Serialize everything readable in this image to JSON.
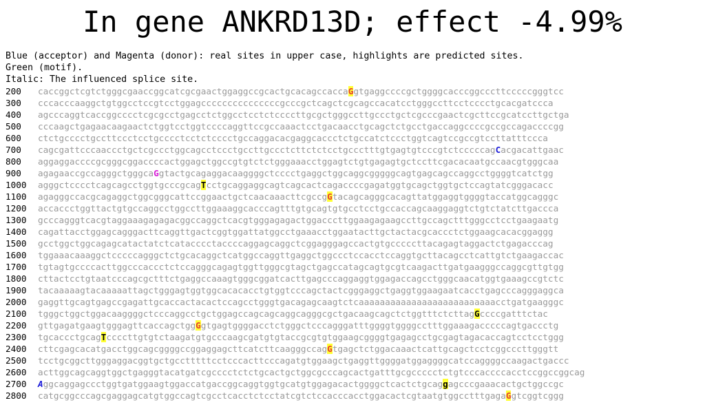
{
  "title": "In gene ANKRD13D; effect -4.99%",
  "legend": [
    "Blue (acceptor) and Magenta (donor): real sites in upper case, highlights are predicted sites.",
    "Green (motif).",
    "Italic: The influenced splice site."
  ],
  "rows": [
    {
      "num": "200",
      "segs": [
        {
          "t": "caccggctcgtctgggcgaaccggcatcgcgaactggaggccgcactgcacagccacca"
        },
        {
          "t": "G",
          "c": "acc",
          "hl": true
        },
        {
          "t": "gtgaggccccgctggggcacccggcccttcccccgggtcc"
        }
      ]
    },
    {
      "num": "300",
      "segs": [
        {
          "t": "cccacccaaggctgtggcctccgtcctggagcccccccccccccccgcccgctcagctcgcagccacatcctgggccttcctcccctgcacgatccca"
        }
      ]
    },
    {
      "num": "400",
      "segs": [
        {
          "t": "agcccaggtcaccggcccctcgcgcctgagcctctggcctcctctccccttgcgctgggccttgccctgctcgcccgaactcgcttccgcatccttgctga"
        }
      ]
    },
    {
      "num": "500",
      "segs": [
        {
          "t": "cccaagctgagaacaagaactctggtcctggtccccaggttccgccaaactcctgacaacctgcagctctgcctgaccaggccccgccgccagaccccgg"
        }
      ]
    },
    {
      "num": "600",
      "segs": [
        {
          "t": "ctctgcccctgccttccctcctgcccctcctctcccctgccaggacacgaggcaccctctgccatctccctggtcagtccgccgtccttatttccca"
        }
      ]
    },
    {
      "num": "700",
      "segs": [
        {
          "t": "cagcgattcccaaccctgctcgccctggcagcctccctgccttgccctcttctctcctgccctttgtgagtgtcccgtctcccccag"
        },
        {
          "t": "C",
          "c": "blu"
        },
        {
          "t": "acgacattgaac"
        }
      ]
    },
    {
      "num": "800",
      "segs": [
        {
          "t": "aggaggaccccgcgggcggaccccactggagctggccgtgtctctgggaaacctggagtctgtgagagtgctccttcgacacaatgccaacgtgggcaa"
        }
      ]
    },
    {
      "num": "900",
      "segs": [
        {
          "t": "agagaaccgccagggctgggca"
        },
        {
          "t": "G",
          "c": "don"
        },
        {
          "t": "gtactgcagaggacaaggggctcccctgaggctggcaggcgggggcagtgagcagccaggcctggggtcatctgg"
        }
      ]
    },
    {
      "num": "1000",
      "segs": [
        {
          "t": "agggctcccctcagcagcctggtgcccgcag"
        },
        {
          "t": "T",
          "c": "blk",
          "hl": true
        },
        {
          "t": "cctgcaggaggcagtcagcactcagaccccgagatggtgcagctggtgctccagtatcgggacacc"
        }
      ]
    },
    {
      "num": "1100",
      "segs": [
        {
          "t": "agagggccacgcagaggctggcgggcattccggaactgctcaacaaacttcgccg"
        },
        {
          "t": "G",
          "c": "acc",
          "hl": true
        },
        {
          "t": "tacagcagggcacagttatggaggtggggtaccatggcagggc"
        }
      ]
    },
    {
      "num": "1200",
      "segs": [
        {
          "t": "accaccctggttactgtgccaggcctggccttggaaaggcacccagtttgtgcagtgtgcctcctgccaccagcaaggaggtctgtctatcttgaccca"
        }
      ]
    },
    {
      "num": "1300",
      "segs": [
        {
          "t": "gcccagggtcacgtaggaaagagagacggccaggctcacgtgggagagactggacccttggaagagaagccttgccagctttgggcctcctgaagaatg"
        }
      ]
    },
    {
      "num": "1400",
      "segs": [
        {
          "t": "cagattacctggagcagggacttcaggttgactcggtggattatggcctgaaacctggaatacttgctactacgcaccctctggaagcacacggaggg"
        }
      ]
    },
    {
      "num": "1500",
      "segs": [
        {
          "t": "gcctggctggcagagcatactatctcatacccctaccccaggagcaggctcggagggagccactgtgcccccttacagagtaggactctgagacccag"
        }
      ]
    },
    {
      "num": "1600",
      "segs": [
        {
          "t": "tggaaacaaaggctcccccagggctctgcacaggctcatggccaggttgaggctggccctccacctccaggtgcttacagcctcattgtctgaagaccac"
        }
      ]
    },
    {
      "num": "1700",
      "segs": [
        {
          "t": "tgtagtgccccacttggcccaccctctccagggcagagtggttgggcgtagctgagccatagcagtgcgtcaagacttgatgaagggccaggcgttgtgg"
        }
      ]
    },
    {
      "num": "1800",
      "segs": [
        {
          "t": "cttactcctgtaatcccagcgctttctgaggccaaagtgggcggatcacttgagcccaggaggtggagaccagcctgggcaacatggtgaaagccgtctc"
        }
      ]
    },
    {
      "num": "1900",
      "segs": [
        {
          "t": "tacaaaaagtacaaaaattagctgggagtggtggcacacacctgtggtcccagctactcgggaggctgaggtggaagaatcacctgagcccagggaggca"
        }
      ]
    },
    {
      "num": "2000",
      "segs": [
        {
          "t": "gaggttgcagtgagccgagattgcaccactacactccagcctgggtgacagagcaagtctcaaaaaaaaaaaaaaaaaaaaaaaaaacctgatgaagggc"
        }
      ]
    },
    {
      "num": "2100",
      "segs": [
        {
          "t": "tgggctggctggacaaggggctcccaggcctgctggagccagcagcaggcagggcgctgacaagcagctctggtttctcttag"
        },
        {
          "t": "G",
          "c": "blk",
          "hl": true
        },
        {
          "t": "ccccgatttctac"
        }
      ]
    },
    {
      "num": "2200",
      "segs": [
        {
          "t": "gttgagatgaagtgggagttcaccagctgg"
        },
        {
          "t": "G",
          "c": "acc",
          "hl": true
        },
        {
          "t": "gtgagtggggacctctgggctcccagggatttggggtggggcctttggaaagacccccagtgaccctg"
        }
      ]
    },
    {
      "num": "2300",
      "segs": [
        {
          "t": "tgcaccctgcag"
        },
        {
          "t": "T",
          "c": "blk",
          "hl": true
        },
        {
          "t": "ccccttgtgtctaagatgtgcccaagcgatgtgtaccgcgtgtggaagcggggtgagagcctgcgagtagacaccagtcctcctggg"
        }
      ]
    },
    {
      "num": "2400",
      "segs": [
        {
          "t": "cttcgagcacatgacctggcagcggggccggaggagcttcatcttcaagggccag"
        },
        {
          "t": "G",
          "c": "acc",
          "hl": true
        },
        {
          "t": "tgagctctggacaaactcattgcagctcctcggcccttgggtt"
        }
      ]
    },
    {
      "num": "2500",
      "segs": [
        {
          "t": "tcctgcggcttgggaggacggtgctgcctttttcctcccacttcccagatgtggaagctgaggttggggatggaggggcatccaggggccaagactgaccc"
        }
      ]
    },
    {
      "num": "2600",
      "segs": [
        {
          "t": "acttggcagcaggtggctgagggtacatgatcgcccctctctgcactgctggcgcccagcactgatttgcgccccctctgtcccaccccacctccggccggcag"
        }
      ]
    },
    {
      "num": "2700",
      "segs": [
        {
          "t": "A",
          "c": "blu",
          "it": true
        },
        {
          "t": "ggcaggagccctggtgatggaagtggaccatgaccggcaggtggtgcatgtggagacactggggctcactctgcag"
        },
        {
          "t": "g",
          "c": "blk",
          "hl": true
        },
        {
          "t": "agcccgaaacactgctggccgc"
        }
      ]
    },
    {
      "num": "2800",
      "segs": [
        {
          "t": "catgcggcccagcgaggagcatgtggccagtcgcctcacctctcctatcgtctccacccacctggacactcgtaatgtggcctttgaga"
        },
        {
          "t": "G",
          "c": "acc",
          "hl": true
        },
        {
          "t": "gtcggtcggg"
        }
      ]
    }
  ]
}
